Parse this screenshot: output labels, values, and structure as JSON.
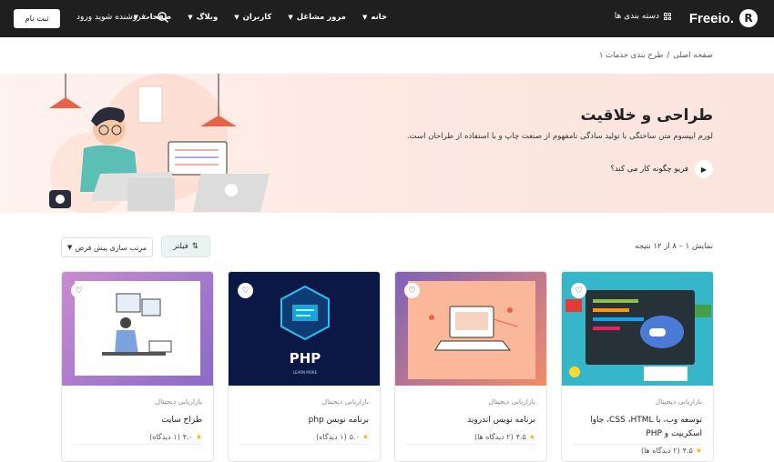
{
  "header": {
    "logo_text": "Freeio.",
    "categories_label": "دسته بندی ها",
    "nav": [
      {
        "label": "خانه"
      },
      {
        "label": "مرور مشاغل"
      },
      {
        "label": "کاربران"
      },
      {
        "label": "وبلاگ"
      },
      {
        "label": "صفحات"
      }
    ],
    "signin_label": "فروشنده شوید     ورود",
    "register_label": "ثبت نام"
  },
  "breadcrumb": {
    "home": "صفحه اصلی",
    "separator": "/",
    "current": "طرح بندی خدمات ۱"
  },
  "hero": {
    "title": "طراحی و خلاقیت",
    "subtitle": "لورم ایپسوم متن ساختگی با تولید سادگی نامفهوم از صنعت چاپ و با استفاده از طراحان است.",
    "cta_label": "فریو چگونه کار می کند؟"
  },
  "toolbar": {
    "result_text": "نمایش ۱ – ۸ از ۱۲ نتیجه",
    "filter_label": "فیلتر",
    "sort_label": "مرتب سازی پیش فرض"
  },
  "cards": [
    {
      "category": "بازاریابی دیجیتال",
      "title": "توسعه وب، با CSS ،HTML، جاوا اسکریپت و PHP",
      "rating": "۴.۵",
      "reviews": "(۲ دیدگاه ها)"
    },
    {
      "category": "بازاریابی دیجیتال",
      "title": "برنامه نویس اندروید",
      "rating": "۴.۵",
      "reviews": "(۲ دیدگاه ها)"
    },
    {
      "category": "بازاریابی دیجیتال",
      "title": "برنامه نویس php",
      "rating": "۵.۰",
      "reviews": "(۱ دیدگاه)"
    },
    {
      "category": "بازاریابی دیجیتال",
      "title": "طراح سایت",
      "rating": "۴.۰",
      "reviews": "(۱ دیدگاه)"
    }
  ],
  "php_thumb": {
    "logo": "PHP",
    "caption": "LEARN MORE"
  },
  "colors": {
    "topbar": "#1f1f1f",
    "hero_bg": "#fde9e3",
    "accent": "#e8624a",
    "star": "#f5b400"
  }
}
